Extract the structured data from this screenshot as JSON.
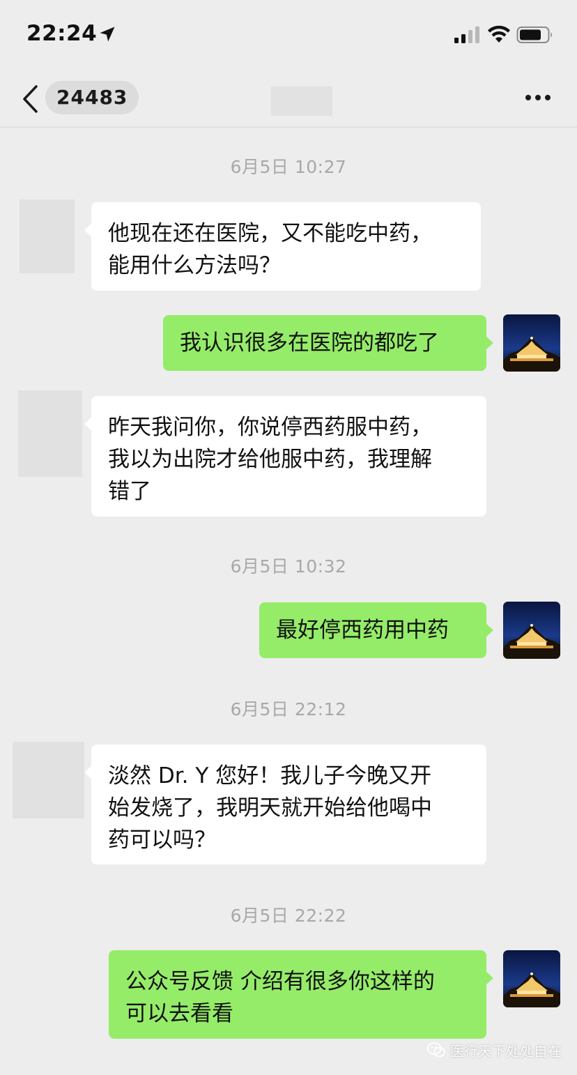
{
  "status_bar": {
    "time": "22:24",
    "icons": [
      "location-arrow-icon",
      "signal-icon",
      "wifi-icon",
      "battery-icon"
    ]
  },
  "nav": {
    "back_icon": "chevron-left-icon",
    "unread_count": "24483",
    "more_icon": "ellipsis-icon"
  },
  "chat": {
    "timestamps": [
      "6月5日 10:27",
      "6月5日 10:32",
      "6月5日 22:12",
      "6月5日 22:22"
    ],
    "messages": [
      {
        "from": "contact",
        "lines": [
          "他现在还在医院，又不能吃中药，",
          "能用什么方法吗？"
        ]
      },
      {
        "from": "self",
        "lines": [
          "我认识很多在医院的都吃了"
        ]
      },
      {
        "from": "contact",
        "lines": [
          "昨天我问你，你说停西药服中药，",
          "我以为出院才给他服中药，我理解",
          "错了"
        ]
      },
      {
        "from": "self",
        "lines": [
          "最好停西药用中药"
        ]
      },
      {
        "from": "contact",
        "lines": [
          "淡然 Dr. Y 您好！我儿子今晚又开",
          "始发烧了，我明天就开始给他喝中",
          "药可以吗？"
        ]
      },
      {
        "from": "self",
        "lines": [
          "公众号反馈 介绍有很多你这样的",
          "可以去看看"
        ]
      }
    ]
  },
  "watermark": {
    "text": "医行天下处处自在"
  },
  "colors": {
    "background": "#ededed",
    "outgoing_bubble": "#95ec69",
    "incoming_bubble": "#ffffff",
    "timestamp_text": "#a8a8a8"
  }
}
